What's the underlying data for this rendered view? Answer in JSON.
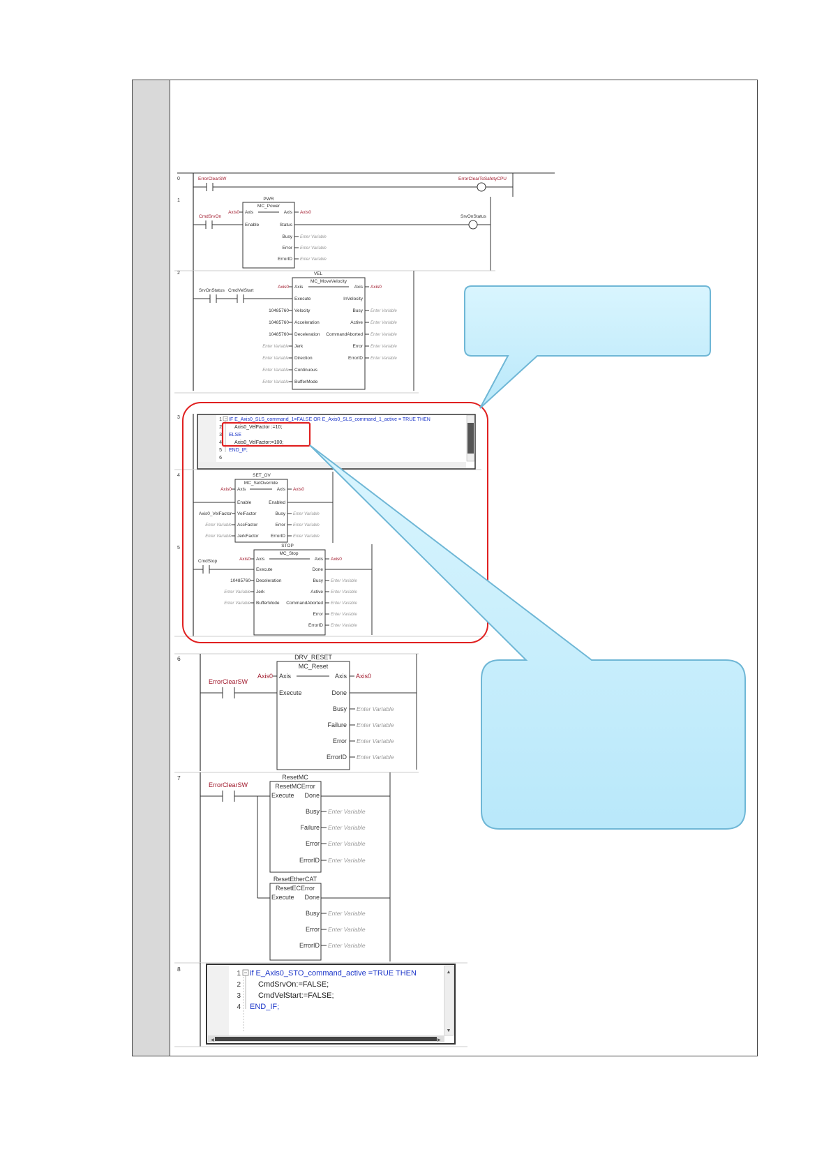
{
  "rungs": {
    "r0": {
      "num": "0",
      "contact": "ErrorClearSW",
      "coil": "ErrorClearToSafetyCPU"
    },
    "r1": {
      "num": "1",
      "instance": "PWR",
      "fb": "MC_Power",
      "contact": "CmdSrvOn",
      "coil": "SrvOnStatus",
      "axis_in": "Axis0",
      "axis_out": "Axis0",
      "pin_axis": "Axis",
      "pin_enable": "Enable",
      "pin_status": "Status",
      "pin_busy": "Busy",
      "pin_error": "Error",
      "pin_errorid": "ErrorID"
    },
    "r2": {
      "num": "2",
      "instance": "VEL",
      "fb": "MC_MoveVelocity",
      "contact1": "SrvOnStatus",
      "contact2": "CmdVelStart",
      "axis_in": "Axis0",
      "axis_out": "Axis0",
      "pin_axis": "Axis",
      "pin_execute": "Execute",
      "pin_velocity": "Velocity",
      "pin_acceleration": "Acceleration",
      "pin_deceleration": "Deceleration",
      "pin_jerk": "Jerk",
      "pin_direction": "Direction",
      "pin_continuous": "Continuous",
      "pin_buffermode": "BufferMode",
      "pin_invelocity": "InVelocity",
      "pin_busy": "Busy",
      "pin_active": "Active",
      "pin_commandaborted": "CommandAborted",
      "pin_error": "Error",
      "pin_errorid": "ErrorID",
      "val_velocity": "10485760",
      "val_acceleration": "10485760",
      "val_deceleration": "10485760"
    },
    "r3": {
      "num": "3",
      "lines": [
        {
          "n": "1",
          "text": "IF E_Axis0_SLS_command_1=FALSE OR  E_Axis0_SLS_command_1_active = TRUE THEN"
        },
        {
          "n": "2",
          "text": "Axis0_VelFactor :=10;"
        },
        {
          "n": "3",
          "text": "ELSE"
        },
        {
          "n": "4",
          "text": "Axis0_VelFactor:=100;"
        },
        {
          "n": "5",
          "text": "END_IF;"
        },
        {
          "n": "6",
          "text": ""
        }
      ]
    },
    "r4": {
      "num": "4",
      "instance": "SET_OV",
      "fb": "MC_SetOverride",
      "axis_in": "Axis0",
      "axis_out": "Axis0",
      "pin_axis": "Axis",
      "pin_enable": "Enable",
      "pin_enabled": "Enabled",
      "pin_velfactor": "VelFactor",
      "pin_accfactor": "AccFactor",
      "pin_jerkfactor": "JerkFactor",
      "pin_busy": "Busy",
      "pin_error": "Error",
      "pin_errorid": "ErrorID",
      "val_velfactor": "Axis0_VelFactor"
    },
    "r5": {
      "num": "5",
      "instance": "STOP",
      "fb": "MC_Stop",
      "contact": "CmdStop",
      "axis_in": "Axis0",
      "axis_out": "Axis0",
      "pin_axis": "Axis",
      "pin_execute": "Execute",
      "pin_deceleration": "Deceleration",
      "pin_jerk": "Jerk",
      "pin_buffermode": "BufferMode",
      "pin_done": "Done",
      "pin_busy": "Busy",
      "pin_active": "Active",
      "pin_commandaborted": "CommandAborted",
      "pin_error": "Error",
      "pin_errorid": "ErrorID",
      "val_deceleration": "10485760"
    },
    "r6": {
      "num": "6",
      "instance": "DRV_RESET",
      "fb": "MC_Reset",
      "contact": "ErrorClearSW",
      "axis_in": "Axis0",
      "axis_out": "Axis0",
      "pin_axis": "Axis",
      "pin_execute": "Execute",
      "pin_done": "Done",
      "pin_busy": "Busy",
      "pin_failure": "Failure",
      "pin_error": "Error",
      "pin_errorid": "ErrorID"
    },
    "r7": {
      "num": "7",
      "contact": "ErrorClearSW",
      "fb1": {
        "instance": "ResetMC",
        "fb": "ResetMCError",
        "pin_execute": "Execute",
        "pin_done": "Done",
        "pin_busy": "Busy",
        "pin_failure": "Failure",
        "pin_error": "Error",
        "pin_errorid": "ErrorID"
      },
      "fb2": {
        "instance": "ResetEtherCAT",
        "fb": "ResetECError",
        "pin_execute": "Execute",
        "pin_done": "Done",
        "pin_busy": "Busy",
        "pin_error": "Error",
        "pin_errorid": "ErrorID"
      }
    },
    "r8": {
      "num": "8",
      "lines": [
        {
          "n": "1",
          "text": "if E_Axis0_STO_command_active =TRUE THEN"
        },
        {
          "n": "2",
          "text": "CmdSrvOn:=FALSE;"
        },
        {
          "n": "3",
          "text": "CmdVelStart:=FALSE;"
        },
        {
          "n": "4",
          "text": "END_IF;"
        }
      ]
    }
  },
  "enter_variable": "Enter Variable",
  "colors": {
    "variable": "#a0182b",
    "keyword": "#1a34c8",
    "highlight": "#e02020",
    "callout_fill": "#c8eefb",
    "callout_border": "#6fb7d6"
  }
}
